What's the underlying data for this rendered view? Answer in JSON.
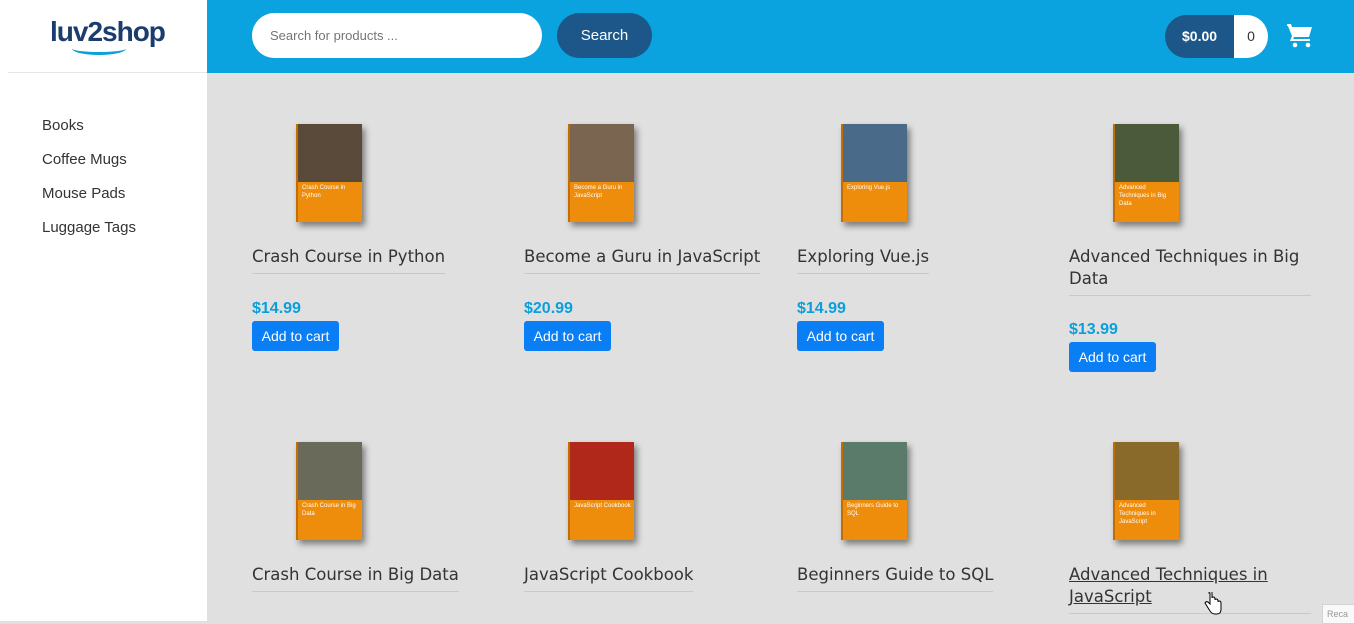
{
  "logo": {
    "text": "luv2shop"
  },
  "sidebar": {
    "categories": [
      {
        "label": "Books"
      },
      {
        "label": "Coffee Mugs"
      },
      {
        "label": "Mouse Pads"
      },
      {
        "label": "Luggage Tags"
      }
    ]
  },
  "header": {
    "search_placeholder": "Search for products ...",
    "search_button": "Search",
    "cart_total": "$0.00",
    "cart_quantity": "0",
    "cart_icon": "shopping-cart-icon"
  },
  "products": [
    {
      "title": "Crash Course in Python",
      "price": "$14.99",
      "button": "Add to cart",
      "cover_text": "Crash Course in Python",
      "cover_color": "#5a4a3a"
    },
    {
      "title": "Become a Guru in JavaScript",
      "price": "$20.99",
      "button": "Add to cart",
      "cover_text": "Become a Guru in JavaScript",
      "cover_color": "#7a6650"
    },
    {
      "title": "Exploring Vue.js",
      "price": "$14.99",
      "button": "Add to cart",
      "cover_text": "Exploring Vue.js",
      "cover_color": "#4a6a8a"
    },
    {
      "title": "Advanced Techniques in Big Data",
      "price": "$13.99",
      "button": "Add to cart",
      "cover_text": "Advanced Techniques in Big Data",
      "cover_color": "#4a5a3a"
    },
    {
      "title": "Crash Course in Big Data",
      "cover_text": "Crash Course in Big Data",
      "cover_color": "#6a6a5a"
    },
    {
      "title": "JavaScript Cookbook",
      "cover_text": "JavaScript Cookbook",
      "cover_color": "#b0281a"
    },
    {
      "title": "Beginners Guide to SQL",
      "cover_text": "Beginners Guide to SQL",
      "cover_color": "#5a7a6a"
    },
    {
      "title": "Advanced Techniques in JavaScript",
      "cover_text": "Advanced Techniques in JavaScript",
      "cover_color": "#8a6a2a"
    }
  ],
  "recaptcha_text": "Reca"
}
